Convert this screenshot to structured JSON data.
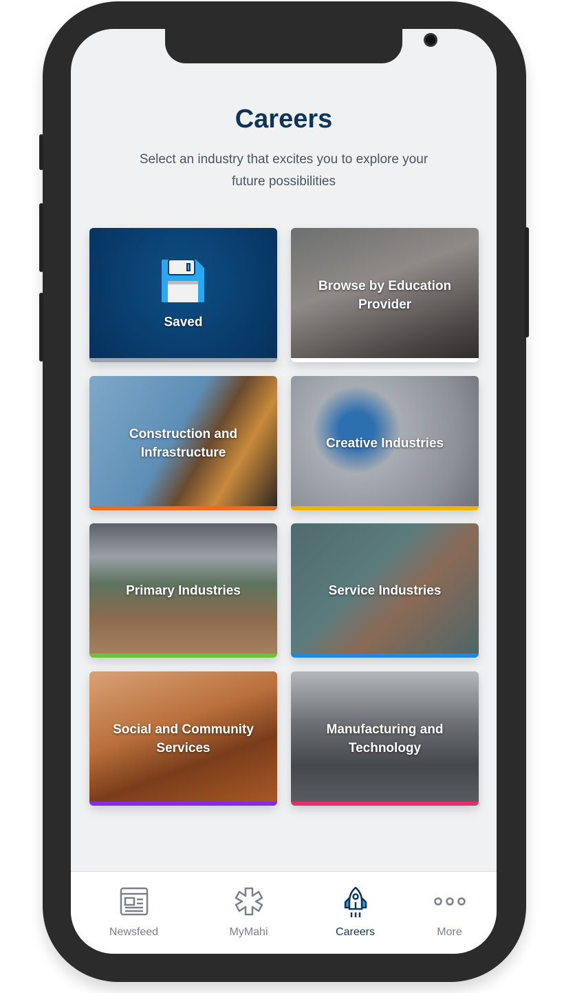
{
  "header": {
    "title": "Careers",
    "subtitle": "Select an industry that excites you to explore your future possibilities"
  },
  "cards": [
    {
      "label": "Saved",
      "icon": "floppy-disk-icon",
      "accent": "#9aa3ad"
    },
    {
      "label": "Browse by Education Provider",
      "accent": "#ffffff"
    },
    {
      "label": "Construction and Infrastructure",
      "accent": "#f06a1a"
    },
    {
      "label": "Creative Industries",
      "accent": "#f0b400"
    },
    {
      "label": "Primary Industries",
      "accent": "#6cc430"
    },
    {
      "label": "Service Industries",
      "accent": "#1e88e5"
    },
    {
      "label": "Social and Community Services",
      "accent": "#8a2be2"
    },
    {
      "label": "Manufacturing and Technology",
      "accent": "#e0306e"
    }
  ],
  "tabbar": {
    "items": [
      {
        "label": "Newsfeed",
        "icon": "newspaper-icon"
      },
      {
        "label": "MyMahi",
        "icon": "asterisk-icon"
      },
      {
        "label": "Careers",
        "icon": "rocket-icon",
        "active": true
      },
      {
        "label": "More",
        "icon": "more-dots-icon"
      }
    ]
  }
}
